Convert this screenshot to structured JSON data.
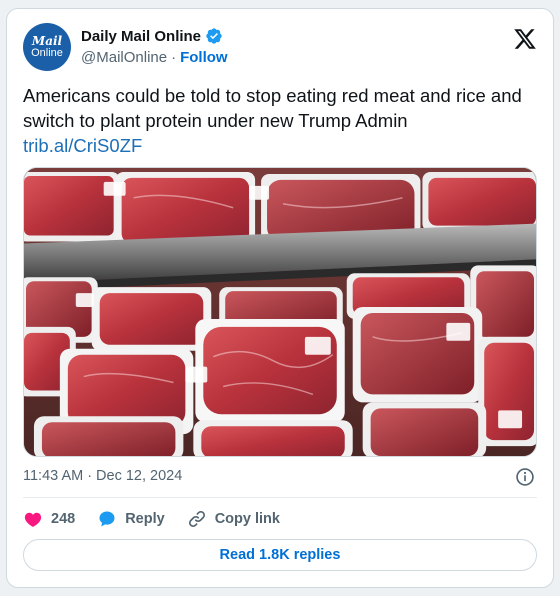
{
  "author": {
    "avatar_line1": "Mail",
    "avatar_line2": "Online",
    "display_name": "Daily Mail Online",
    "handle": "@MailOnline",
    "separator": "·",
    "follow_label": "Follow"
  },
  "tweet": {
    "text": "Americans could be told to stop eating red meat and rice and switch to plant protein under new Trump Admin",
    "link": "trib.al/CriS0ZF",
    "time": "11:43 AM",
    "date_separator": "·",
    "date": "Dec 12, 2024"
  },
  "actions": {
    "likes": "248",
    "reply_label": "Reply",
    "copy_label": "Copy link",
    "read_replies_label": "Read 1.8K replies"
  },
  "icons": {
    "verified": "verified-badge-icon",
    "x_logo": "x-logo-icon",
    "info": "info-icon",
    "like": "heart-icon",
    "reply": "speech-bubble-icon",
    "copy": "link-icon"
  },
  "colors": {
    "brand_blue": "#1b5fa8",
    "link_blue": "#006fd6",
    "heart": "#f91880",
    "verified": "#1d9bf0",
    "muted": "#536471"
  }
}
